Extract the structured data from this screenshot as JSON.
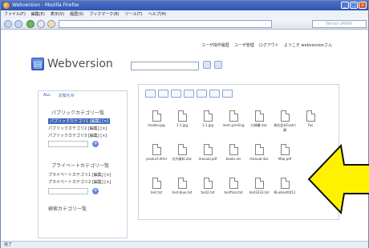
{
  "window": {
    "title": "Webversion - Mozilla Firefox",
    "menu": [
      "ファイル(F)",
      "編集(E)",
      "表示(V)",
      "履歴(S)",
      "ブックマーク(B)",
      "ツール(T)",
      "ヘルプ(H)"
    ]
  },
  "top_links": [
    "ユーザ操作履歴",
    "ユーザ管理",
    "ログアウト",
    "ようこそ webversionさん"
  ],
  "brand": "Webversion",
  "left": {
    "top_items": [
      "ALL",
      "お知らせ"
    ],
    "public_title": "パブリックカテゴリ一覧",
    "public_items": [
      "パブリックカテゴリ1 [編集] [×]",
      "パブリックカテゴリ2 [編集] [×]",
      "パブリックカテゴリ3 [編集] [×]"
    ],
    "private_title": "プライベートカテゴリ一覧",
    "private_items": [
      "プライベートカテゴリ1 [編集] [×]",
      "プライベートカテゴリ2 [編集] [×]"
    ],
    "search_label": "検索カテゴリ一覧"
  },
  "files_row1": [
    "header.jpg",
    "1-1.jpg",
    "1-1.jpg",
    "mem.printing",
    "仕様書.doc",
    "株式会社Fastcl課",
    "Fas"
  ],
  "files_row2": [
    "product.html",
    "社内資料.doc",
    "manual.pdf",
    "books.xls",
    "manual.doc",
    "Map.pdf"
  ],
  "files_row3": [
    "test.txt",
    "test-blue.txt",
    "test2.txt",
    "testfinal.txt",
    "test3333.txt",
    "Bluetext0011"
  ],
  "status": "完了"
}
